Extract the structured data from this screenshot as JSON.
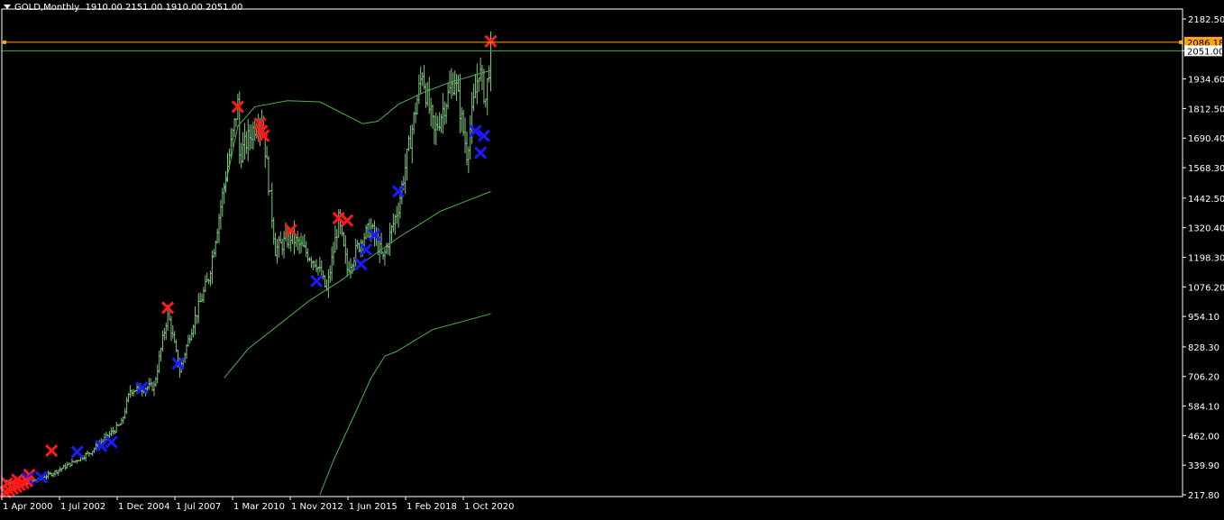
{
  "header": {
    "symbol": "GOLD,Monthly",
    "ohlc": "1910.00 2151.00 1910.00 2051.00"
  },
  "colors": {
    "background": "#000000",
    "axis": "#ffffff",
    "bars": "#7fc47f",
    "ma_line": "#49b149",
    "bid_line": "#ffa500",
    "sell_marker": "#ff1a1a",
    "buy_marker": "#1a1aff"
  },
  "chart_data": {
    "type": "bar",
    "series_name": "GOLD,Monthly",
    "x_labels": [
      "1 Apr 2000",
      "1 Jul 2002",
      "1 Dec 2004",
      "1 Jul 2007",
      "1 Mar 2010",
      "1 Nov 2012",
      "1 Jun 2015",
      "1 Feb 2018",
      "1 Oct 2020"
    ],
    "y_ticks": [
      "2182.50",
      "2051.00",
      "1934.60",
      "1812.50",
      "1690.40",
      "1568.30",
      "1442.50",
      "1320.40",
      "1198.30",
      "1076.20",
      "954.10",
      "828.30",
      "706.20",
      "584.10",
      "462.00",
      "339.90",
      "217.80"
    ],
    "ylim": [
      217.8,
      2182.5
    ],
    "price_labels": [
      {
        "name": "bid",
        "label": "2086.18",
        "value": 2086.18
      },
      {
        "name": "last",
        "label": "2051.00",
        "value": 2051.0
      }
    ],
    "closes": [
      {
        "date": "2000-04",
        "value": 275
      },
      {
        "date": "2001-04",
        "value": 262
      },
      {
        "date": "2002-07",
        "value": 305
      },
      {
        "date": "2003-06",
        "value": 346
      },
      {
        "date": "2004-06",
        "value": 395
      },
      {
        "date": "2004-12",
        "value": 435
      },
      {
        "date": "2005-12",
        "value": 513
      },
      {
        "date": "2006-05",
        "value": 650
      },
      {
        "date": "2007-07",
        "value": 665
      },
      {
        "date": "2008-03",
        "value": 970
      },
      {
        "date": "2008-10",
        "value": 730
      },
      {
        "date": "2009-06",
        "value": 930
      },
      {
        "date": "2010-03",
        "value": 1115
      },
      {
        "date": "2011-08",
        "value": 1830
      },
      {
        "date": "2011-09",
        "value": 1620
      },
      {
        "date": "2012-09",
        "value": 1780
      },
      {
        "date": "2012-11",
        "value": 1715
      },
      {
        "date": "2013-06",
        "value": 1230
      },
      {
        "date": "2014-03",
        "value": 1285
      },
      {
        "date": "2015-06",
        "value": 1175
      },
      {
        "date": "2015-12",
        "value": 1060
      },
      {
        "date": "2016-07",
        "value": 1350
      },
      {
        "date": "2016-12",
        "value": 1150
      },
      {
        "date": "2017-09",
        "value": 1280
      },
      {
        "date": "2018-02",
        "value": 1320
      },
      {
        "date": "2018-09",
        "value": 1190
      },
      {
        "date": "2019-06",
        "value": 1410
      },
      {
        "date": "2020-08",
        "value": 1970
      },
      {
        "date": "2020-10",
        "value": 1880
      },
      {
        "date": "2021-03",
        "value": 1710
      },
      {
        "date": "2021-08",
        "value": 1810
      },
      {
        "date": "2022-03",
        "value": 1940
      },
      {
        "date": "2022-10",
        "value": 1630
      },
      {
        "date": "2023-05",
        "value": 1980
      },
      {
        "date": "2023-09",
        "value": 1850
      },
      {
        "date": "2023-12",
        "value": 2051
      }
    ],
    "moving_averages": [
      {
        "name": "ma_short",
        "points": [
          {
            "date": "2010-12",
            "value": 1470
          },
          {
            "date": "2011-08",
            "value": 1740
          },
          {
            "date": "2012-06",
            "value": 1820
          },
          {
            "date": "2014-01",
            "value": 1845
          },
          {
            "date": "2015-08",
            "value": 1840
          },
          {
            "date": "2016-10",
            "value": 1790
          },
          {
            "date": "2017-09",
            "value": 1750
          },
          {
            "date": "2018-06",
            "value": 1760
          },
          {
            "date": "2019-06",
            "value": 1830
          },
          {
            "date": "2020-09",
            "value": 1880
          },
          {
            "date": "2021-12",
            "value": 1920
          },
          {
            "date": "2023-12",
            "value": 1970
          }
        ]
      },
      {
        "name": "ma_medium",
        "points": [
          {
            "date": "2010-12",
            "value": 700
          },
          {
            "date": "2012-02",
            "value": 820
          },
          {
            "date": "2013-08",
            "value": 920
          },
          {
            "date": "2015-02",
            "value": 1020
          },
          {
            "date": "2016-10",
            "value": 1110
          },
          {
            "date": "2017-08",
            "value": 1170
          },
          {
            "date": "2019-06",
            "value": 1280
          },
          {
            "date": "2021-07",
            "value": 1390
          },
          {
            "date": "2023-12",
            "value": 1470
          }
        ]
      },
      {
        "name": "ma_long",
        "points": [
          {
            "date": "2015-08",
            "value": 217.8
          },
          {
            "date": "2016-04",
            "value": 360
          },
          {
            "date": "2017-05",
            "value": 560
          },
          {
            "date": "2018-02",
            "value": 700
          },
          {
            "date": "2018-10",
            "value": 790
          },
          {
            "date": "2019-05",
            "value": 810
          },
          {
            "date": "2021-02",
            "value": 900
          },
          {
            "date": "2023-12",
            "value": 965
          }
        ]
      }
    ],
    "markers": [
      {
        "type": "sell",
        "date": "2000-05",
        "value": 265
      },
      {
        "type": "sell",
        "date": "2000-11",
        "value": 280
      },
      {
        "type": "sell",
        "date": "2001-06",
        "value": 300
      },
      {
        "type": "sell",
        "date": "2002-07",
        "value": 400
      },
      {
        "type": "sell",
        "date": "2008-03",
        "value": 990
      },
      {
        "type": "sell",
        "date": "2011-08",
        "value": 1820
      },
      {
        "type": "sell",
        "date": "2012-09",
        "value": 1750
      },
      {
        "type": "sell",
        "date": "2012-10",
        "value": 1720
      },
      {
        "type": "sell",
        "date": "2012-11",
        "value": 1700
      },
      {
        "type": "sell",
        "date": "2014-03",
        "value": 1310
      },
      {
        "type": "sell",
        "date": "2016-07",
        "value": 1360
      },
      {
        "type": "sell",
        "date": "2016-12",
        "value": 1350
      },
      {
        "type": "sell",
        "date": "2023-12",
        "value": 2090
      },
      {
        "type": "buy",
        "date": "2001-05",
        "value": 285
      },
      {
        "type": "buy",
        "date": "2002-01",
        "value": 290
      },
      {
        "type": "buy",
        "date": "2003-10",
        "value": 395
      },
      {
        "type": "buy",
        "date": "2004-12",
        "value": 420
      },
      {
        "type": "buy",
        "date": "2005-06",
        "value": 435
      },
      {
        "type": "buy",
        "date": "2006-12",
        "value": 660
      },
      {
        "type": "buy",
        "date": "2008-09",
        "value": 760
      },
      {
        "type": "buy",
        "date": "2015-06",
        "value": 1100
      },
      {
        "type": "buy",
        "date": "2017-08",
        "value": 1170
      },
      {
        "type": "buy",
        "date": "2017-11",
        "value": 1230
      },
      {
        "type": "buy",
        "date": "2018-04",
        "value": 1290
      },
      {
        "type": "buy",
        "date": "2019-06",
        "value": 1470
      },
      {
        "type": "buy",
        "date": "2023-03",
        "value": 1720
      },
      {
        "type": "buy",
        "date": "2023-08",
        "value": 1700
      },
      {
        "type": "buy",
        "date": "2023-06",
        "value": 1630
      }
    ],
    "grid": false,
    "legend": "none"
  }
}
